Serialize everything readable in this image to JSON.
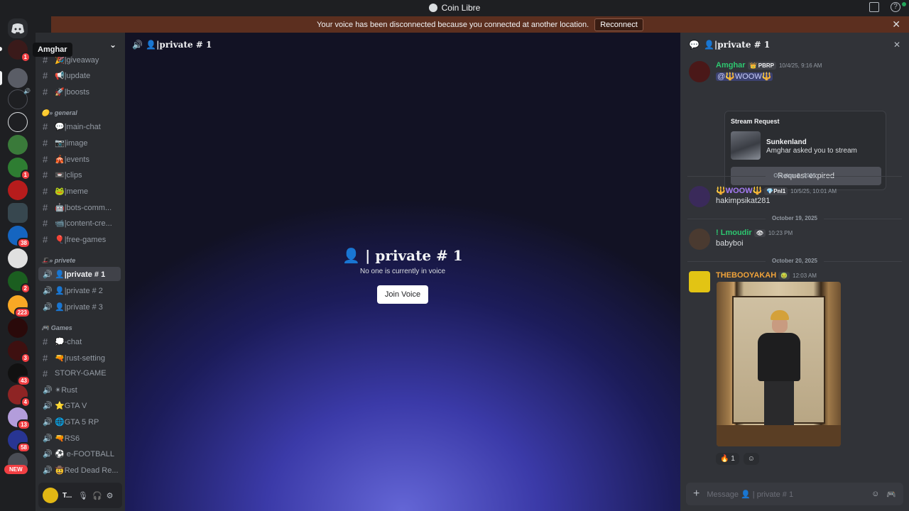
{
  "window": {
    "title": "Coin Libre"
  },
  "notice": {
    "text": "Your voice has been disconnected because you connected at another location.",
    "reconnect_label": "Reconnect",
    "close_label": "✕"
  },
  "tooltip": "Amghar",
  "guild_badges": [
    "1",
    "1",
    "38",
    "2",
    "223",
    "3",
    "43",
    "4",
    "13",
    "58"
  ],
  "new_badge": "NEW",
  "sidebar": {
    "server_name": "re",
    "channels": [
      {
        "icon": "#",
        "label": "🎉|giveaway"
      },
      {
        "icon": "#",
        "label": "📢|update"
      },
      {
        "icon": "#",
        "label": "🚀|boosts"
      },
      {
        "icon": "#",
        "label": "💬|main-chat"
      },
      {
        "icon": "#",
        "label": "📷|image"
      },
      {
        "icon": "#",
        "label": "🎪|events"
      },
      {
        "icon": "#",
        "label": "📼|clips"
      },
      {
        "icon": "#",
        "label": "🐸|meme"
      },
      {
        "icon": "#",
        "label": "🤖|bots-comm..."
      },
      {
        "icon": "#",
        "label": "📹|content-cre..."
      },
      {
        "icon": "#",
        "label": "🎈|free-games"
      },
      {
        "icon": "🔊",
        "label": "👤|private # 1"
      },
      {
        "icon": "🔊",
        "label": "👤|private # 2"
      },
      {
        "icon": "🔊",
        "label": "👤|private # 3"
      },
      {
        "icon": "#",
        "label": "💭-chat"
      },
      {
        "icon": "#",
        "label": "🔫|rust-setting"
      },
      {
        "icon": "#",
        "label": "STORY-GAME"
      },
      {
        "icon": "🔊",
        "label": "✴Rust"
      },
      {
        "icon": "🔊",
        "label": "⭐GTA V"
      },
      {
        "icon": "🔊",
        "label": "🌐GTA 5 RP"
      },
      {
        "icon": "🔊",
        "label": "🔫RS6"
      },
      {
        "icon": "🔊",
        "label": "⚽ e-FOOTBALL"
      },
      {
        "icon": "🔊",
        "label": "🤠Red Dead Re..."
      }
    ],
    "categories": [
      "🟡» general",
      "🎩» privete",
      "🎮 Games"
    ],
    "user": {
      "name": "T..."
    }
  },
  "stage": {
    "channel_title": "👤|private # 1",
    "center_title": "👤 | private # 1",
    "center_sub": "No one is currently in voice",
    "join_label": "Join Voice"
  },
  "chat": {
    "header": "👤|private # 1",
    "close": "✕",
    "messages": [
      {
        "author": "Amghar",
        "tag": "👑 PBRP",
        "time": "10/4/25, 9:16 AM",
        "text": "@🔱WOOW🔱",
        "color": "#2dc770"
      },
      {
        "author": "🔱WOOW🔱",
        "tag": "💎Pnl1",
        "time": "10/5/25, 10:01 AM",
        "text": "hakimpsikat281",
        "color": "#a57bf5"
      },
      {
        "author": "! Lmoudir",
        "tag": "👁",
        "time": "10:23 PM",
        "text": "babyboi",
        "color": "#2dc770"
      },
      {
        "author": "THEBOOYAKAH",
        "tag": "🤢",
        "time": "12:03 AM",
        "text": "",
        "color": "#f0a33a"
      }
    ],
    "stream": {
      "heading": "Stream Request",
      "game": "Sunkenland",
      "sub": "Amghar asked you to stream",
      "expired": "Request expired"
    },
    "dates": [
      "October 5, 2025",
      "October 19, 2025",
      "October 20, 2025"
    ],
    "reaction": {
      "emoji": "🔥",
      "count": "1"
    },
    "composer_placeholder": "Message 👤 | private # 1"
  },
  "colors": {
    "accent": "#5865f2",
    "danger": "#f23f43",
    "online": "#23a55a"
  }
}
